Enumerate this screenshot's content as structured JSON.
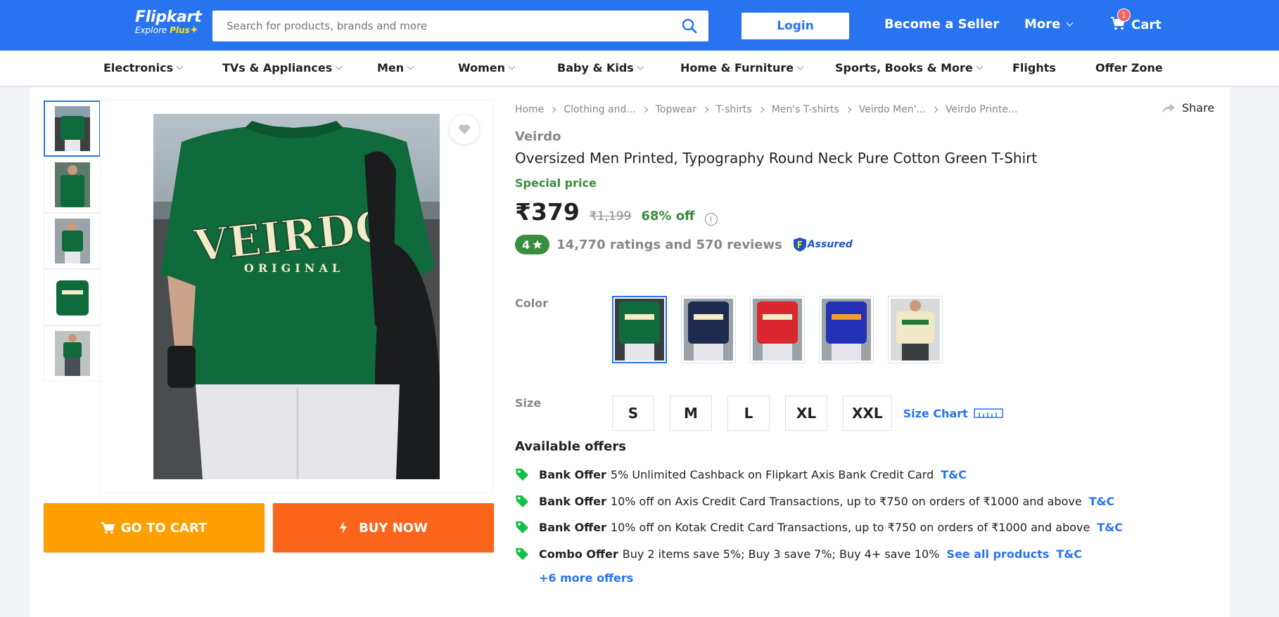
{
  "header": {
    "logo_brand": "Flipkart",
    "logo_sub": "Explore",
    "logo_plus": "Plus",
    "search_placeholder": "Search for products, brands and more",
    "login_label": "Login",
    "seller_label": "Become a Seller",
    "more_label": "More",
    "cart_label": "Cart",
    "cart_count": "1"
  },
  "categories": [
    "Electronics",
    "TVs & Appliances",
    "Men",
    "Women",
    "Baby & Kids",
    "Home & Furniture",
    "Sports, Books & More",
    "Flights",
    "Offer Zone"
  ],
  "breadcrumb": [
    "Home",
    "Clothing and...",
    "Topwear",
    "T-shirts",
    "Men's T-shirts",
    "Veirdo Men'...",
    "Veirdo Printe..."
  ],
  "share_label": "Share",
  "product": {
    "brand": "Veirdo",
    "title": "Oversized Men Printed, Typography Round Neck Pure Cotton Green T-Shirt",
    "special_label": "Special price",
    "price": "₹379",
    "mrp": "₹1,199",
    "discount": "68% off",
    "rating": "4",
    "ratings_text": "14,770 ratings and 570 reviews",
    "assured_label": "Assured",
    "print_text_main": "VEIRDO",
    "print_text_sub": "ORIGINAL"
  },
  "color_label": "Color",
  "colors": [
    {
      "name": "green",
      "hex": "#0f6b3c",
      "print": "#f3ecc8"
    },
    {
      "name": "navy",
      "hex": "#1e2b4f",
      "print": "#f3ecc8"
    },
    {
      "name": "red",
      "hex": "#d9262f",
      "print": "#f3ecc8"
    },
    {
      "name": "royal-blue",
      "hex": "#2231b5",
      "print": "#f49b2e"
    },
    {
      "name": "cream",
      "hex": "#efe9c8",
      "print": "#1e7a3a"
    }
  ],
  "size_label": "Size",
  "sizes": [
    "S",
    "M",
    "L",
    "XL",
    "XXL"
  ],
  "size_chart_label": "Size Chart",
  "offers_heading": "Available offers",
  "offers": [
    {
      "type": "Bank Offer",
      "text": "5% Unlimited Cashback on Flipkart Axis Bank Credit Card",
      "link": "",
      "tc": "T&C"
    },
    {
      "type": "Bank Offer",
      "text": "10% off on Axis Credit Card Transactions, up to ₹750 on orders of ₹1000 and above",
      "link": "",
      "tc": "T&C"
    },
    {
      "type": "Bank Offer",
      "text": "10% off on Kotak Credit Card Transactions, up to ₹750 on orders of ₹1000 and above",
      "link": "",
      "tc": "T&C"
    },
    {
      "type": "Combo Offer",
      "text": "Buy 2 items save 5%; Buy 3 save 7%; Buy 4+ save 10%",
      "link": "See all products",
      "tc": "T&C"
    }
  ],
  "more_offers_label": "+6 more offers",
  "buttons": {
    "go_to_cart": "GO TO CART",
    "buy_now": "BUY NOW"
  },
  "colors_ui": {
    "primary": "#2874f0",
    "cart_btn": "#ff9f00",
    "buy_btn": "#fb641b",
    "green": "#388e3c"
  }
}
